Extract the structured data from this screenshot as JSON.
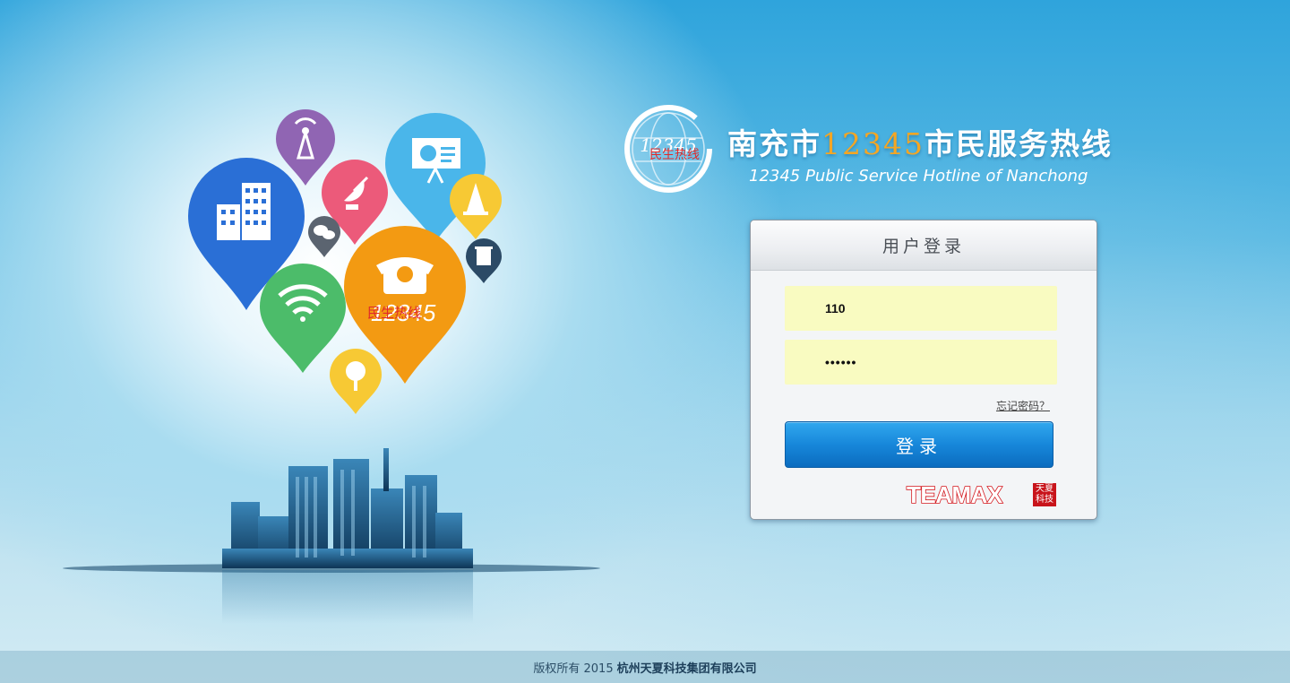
{
  "header": {
    "logo_number": "12345",
    "logo_tag": "民生热线",
    "title_prefix": "南充市",
    "title_number": "12345",
    "title_suffix": "市民服务热线",
    "subtitle": "12345 Public Service Hotline of Nanchong"
  },
  "illustration": {
    "phone_pin_number": "12345",
    "phone_pin_label": "民生热线"
  },
  "login": {
    "title": "用户登录",
    "username_value": "110",
    "password_value": "••••••",
    "forgot_label": "忘记密码？",
    "submit_label": "登录",
    "brand_name": "TEAMAX",
    "brand_seal": "天夏科技"
  },
  "footer": {
    "copyright": "版权所有 2015",
    "company": "杭州天夏科技集团有限公司"
  },
  "colors": {
    "accent_blue": "#1787da",
    "title_number_orange": "#f5a623",
    "field_bg": "#f9fbc1",
    "brand_red": "#d4161c"
  }
}
